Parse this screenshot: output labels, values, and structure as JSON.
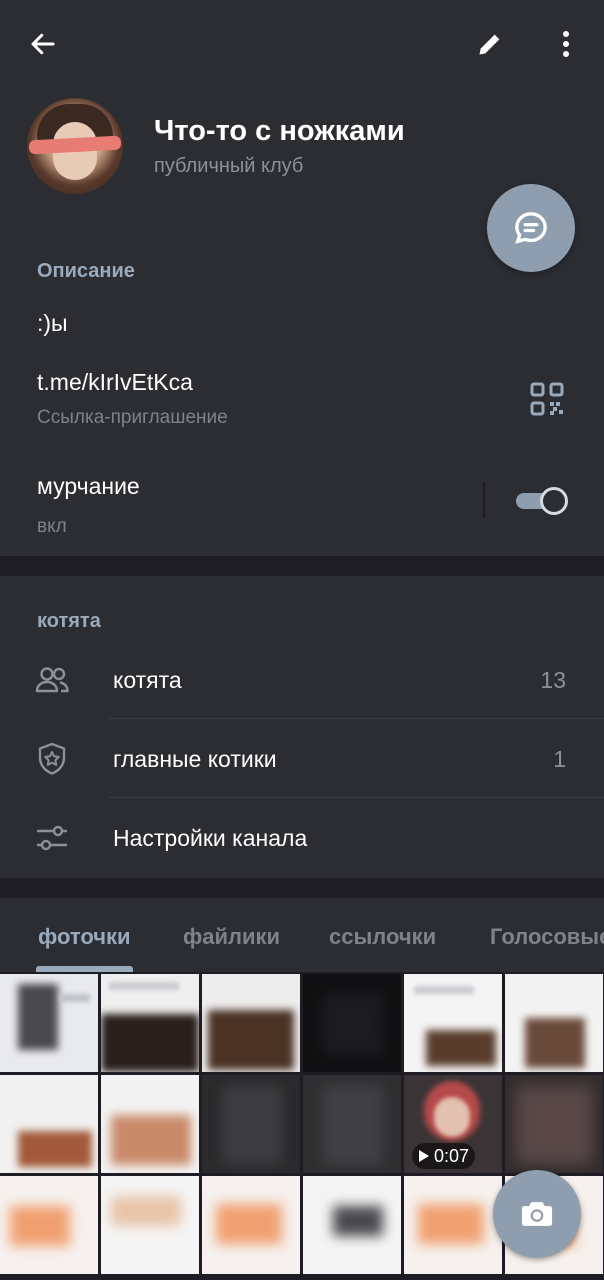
{
  "header": {
    "title": "Что-то с ножками",
    "subtitle": "публичный клуб"
  },
  "icons": {
    "back": "arrow-left-icon",
    "edit": "pencil-icon",
    "menu": "more-vertical-icon",
    "chat": "chat-bubble-icon",
    "qr": "qr-code-icon",
    "members": "people-icon",
    "admins": "shield-star-icon",
    "settings": "sliders-icon",
    "camera": "camera-icon",
    "play": "play-icon"
  },
  "info": {
    "heading": "Описание",
    "description": ":)ы",
    "link": "t.me/kIrIvEtKca",
    "link_caption": "Ссылка-приглашение",
    "setting_name": "мурчание",
    "setting_value": "вкл",
    "toggle_on": true
  },
  "members": {
    "heading": "котята",
    "rows": [
      {
        "label": "котята",
        "count": "13"
      },
      {
        "label": "главные котики",
        "count": "1"
      },
      {
        "label": "Настройки канала",
        "count": ""
      }
    ]
  },
  "tabs": [
    {
      "label": "фоточки",
      "active": true
    },
    {
      "label": "файлики",
      "active": false
    },
    {
      "label": "ссылочки",
      "active": false
    },
    {
      "label": "Голосовые",
      "active": false
    }
  ],
  "media": {
    "video_duration": "0:07"
  },
  "colors": {
    "background": "#1d1d23",
    "surface": "#2b2d33",
    "accent": "#9aaabd",
    "fab": "#8f9eae",
    "secondary_text": "#8d9196"
  }
}
